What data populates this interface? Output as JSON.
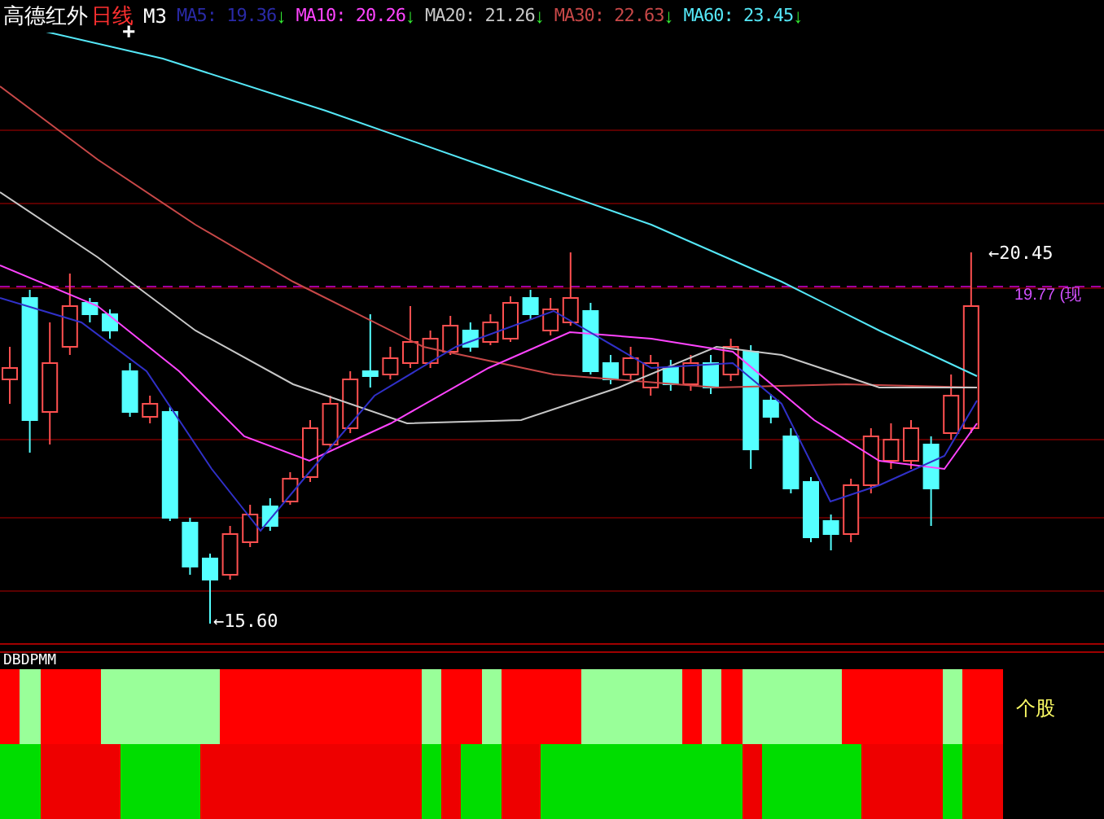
{
  "header": {
    "stock": "高德红外",
    "period": "日线",
    "mode": "M3",
    "cursor": "+",
    "indicators": [
      {
        "name": "MA5:",
        "value": "19.36",
        "arrow": "↓",
        "color": "#2a2aa8"
      },
      {
        "name": "MA10:",
        "value": "20.26",
        "arrow": "↓",
        "color": "#ff44ff"
      },
      {
        "name": "MA20:",
        "value": "21.26",
        "arrow": "↓",
        "color": "#c8c8c8"
      },
      {
        "name": "MA30:",
        "value": "22.63",
        "arrow": "↓",
        "color": "#c84848"
      },
      {
        "name": "MA60:",
        "value": "23.45",
        "arrow": "↓",
        "color": "#55e8f8"
      }
    ]
  },
  "price_chart": {
    "high_label": "←20.45",
    "price_label": "19.77 (现",
    "low_label": "←15.60"
  },
  "indicator": {
    "title": "DBDPMM",
    "label": "个股",
    "rows": [
      {
        "bars": [
          {
            "color": "#ff0000"
          },
          {
            "color": "#99ff99"
          },
          {
            "color": "#ff0000"
          },
          {
            "color": "#ff0000"
          },
          {
            "color": "#ff0000"
          },
          {
            "color": "#99ff99"
          },
          {
            "color": "#99ff99"
          },
          {
            "color": "#99ff99"
          },
          {
            "color": "#99ff99"
          },
          {
            "color": "#99ff99"
          },
          {
            "color": "#99ff99"
          },
          {
            "color": "#ff0000"
          },
          {
            "color": "#ff0000"
          },
          {
            "color": "#ff0000"
          },
          {
            "color": "#ff0000"
          },
          {
            "color": "#ff0000"
          },
          {
            "color": "#ff0000"
          },
          {
            "color": "#ff0000"
          },
          {
            "color": "#ff0000"
          },
          {
            "color": "#ff0000"
          },
          {
            "color": "#ff0000"
          },
          {
            "color": "#99ff99"
          },
          {
            "color": "#ff0000"
          },
          {
            "color": "#ff0000"
          },
          {
            "color": "#99ff99"
          },
          {
            "color": "#ff0000"
          },
          {
            "color": "#ff0000"
          },
          {
            "color": "#ff0000"
          },
          {
            "color": "#ff0000"
          },
          {
            "color": "#99ff99"
          },
          {
            "color": "#99ff99"
          },
          {
            "color": "#99ff99"
          },
          {
            "color": "#99ff99"
          },
          {
            "color": "#99ff99"
          },
          {
            "color": "#ff0000"
          },
          {
            "color": "#99ff99"
          },
          {
            "color": "#ff0000"
          },
          {
            "color": "#99ff99"
          },
          {
            "color": "#99ff99"
          },
          {
            "color": "#99ff99"
          },
          {
            "color": "#99ff99"
          },
          {
            "color": "#99ff99"
          },
          {
            "color": "#ff0000"
          },
          {
            "color": "#ff0000"
          },
          {
            "color": "#ff0000"
          },
          {
            "color": "#ff0000"
          },
          {
            "color": "#ff0000"
          },
          {
            "color": "#99ff99"
          },
          {
            "color": "#ff0000"
          },
          {
            "color": "#ff0000"
          }
        ]
      },
      {
        "bars": [
          {
            "color": "#00dd00"
          },
          {
            "color": "#00dd00"
          },
          {
            "color": "#ee0000"
          },
          {
            "color": "#ee0000"
          },
          {
            "color": "#ee0000"
          },
          {
            "color": "#ee0000"
          },
          {
            "color": "#00dd00"
          },
          {
            "color": "#00dd00"
          },
          {
            "color": "#00dd00"
          },
          {
            "color": "#00dd00"
          },
          {
            "color": "#ee0000"
          },
          {
            "color": "#ee0000"
          },
          {
            "color": "#ee0000"
          },
          {
            "color": "#ee0000"
          },
          {
            "color": "#ee0000"
          },
          {
            "color": "#ee0000"
          },
          {
            "color": "#ee0000"
          },
          {
            "color": "#ee0000"
          },
          {
            "color": "#ee0000"
          },
          {
            "color": "#ee0000"
          },
          {
            "color": "#ee0000"
          },
          {
            "color": "#00dd00"
          },
          {
            "color": "#ee0000"
          },
          {
            "color": "#00dd00"
          },
          {
            "color": "#00dd00"
          },
          {
            "color": "#ee0000"
          },
          {
            "color": "#ee0000"
          },
          {
            "color": "#00dd00"
          },
          {
            "color": "#00dd00"
          },
          {
            "color": "#00dd00"
          },
          {
            "color": "#00dd00"
          },
          {
            "color": "#00dd00"
          },
          {
            "color": "#00dd00"
          },
          {
            "color": "#00dd00"
          },
          {
            "color": "#00dd00"
          },
          {
            "color": "#00dd00"
          },
          {
            "color": "#00dd00"
          },
          {
            "color": "#ee0000"
          },
          {
            "color": "#00dd00"
          },
          {
            "color": "#00dd00"
          },
          {
            "color": "#00dd00"
          },
          {
            "color": "#00dd00"
          },
          {
            "color": "#00dd00"
          },
          {
            "color": "#ee0000"
          },
          {
            "color": "#ee0000"
          },
          {
            "color": "#ee0000"
          },
          {
            "color": "#ee0000"
          },
          {
            "color": "#00dd00"
          },
          {
            "color": "#ee0000"
          },
          {
            "color": "#ee0000"
          }
        ]
      }
    ]
  }
}
